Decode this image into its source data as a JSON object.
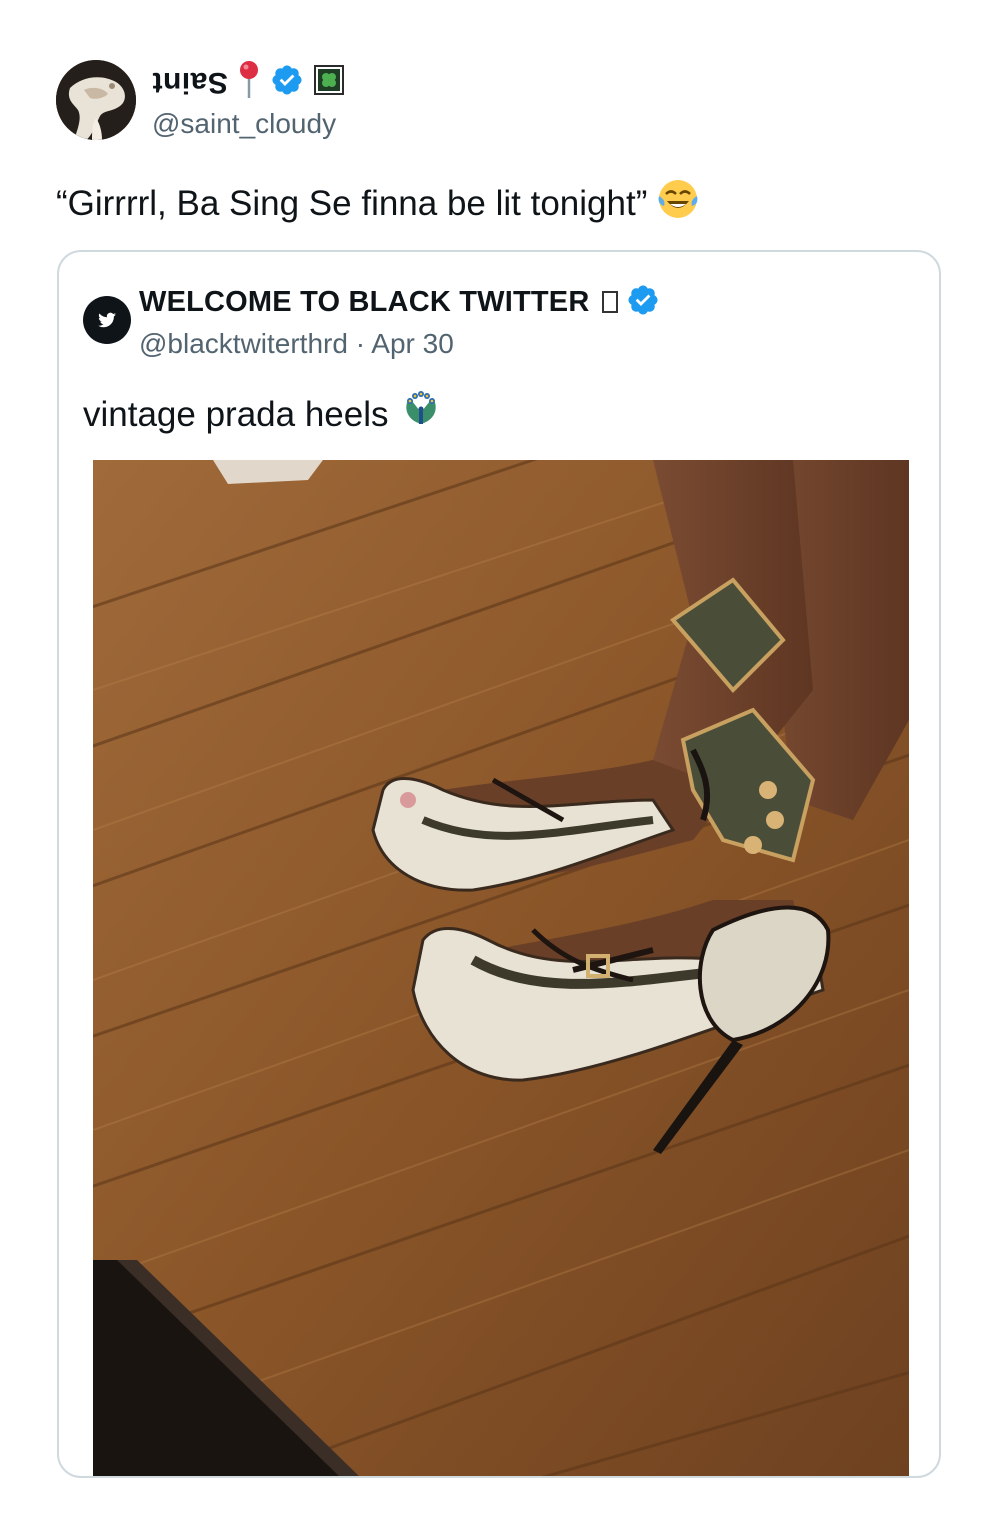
{
  "tweet": {
    "author": {
      "display_name": "Saint",
      "handle": "@saint_cloudy"
    },
    "text": "“Girrrrl, Ba Sing Se finna be lit tonight”",
    "emoji": "😂"
  },
  "quoted": {
    "author": {
      "display_name": "WELCOME TO BLACK TWITTER",
      "handle": "@blacktwiterthrd",
      "separator": "·",
      "date": "Apr 30"
    },
    "text": "vintage prada heels",
    "emoji": "🦚"
  },
  "icons": {
    "pin": "round-pushpin-icon",
    "verified": "verified-badge-icon",
    "clover": "four-leaf-clover-icon",
    "bird": "twitter-bird-icon"
  },
  "colors": {
    "verified_blue": "#1d9bf0",
    "secondary_text": "#536471",
    "border": "#cfd9de"
  }
}
